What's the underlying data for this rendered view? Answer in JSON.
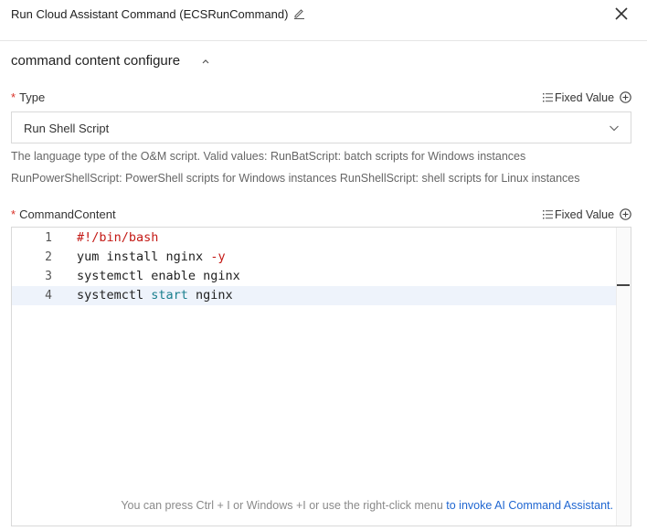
{
  "header": {
    "title": "Run Cloud Assistant Command (ECSRunCommand)",
    "edit_icon": "pencil-icon",
    "close_icon": "close-icon"
  },
  "section": {
    "title": "command content configure",
    "collapse_icon": "chevron-up-icon"
  },
  "type_field": {
    "required_mark": "*",
    "label": "Type",
    "fixed_value_label": "Fixed Value",
    "selected_value": "Run Shell Script",
    "help_line_1": "The language type of the O&M script. Valid values: RunBatScript: batch scripts for Windows instances",
    "help_line_2": "RunPowerShellScript: PowerShell scripts for Windows instances RunShellScript: shell scripts for Linux instances"
  },
  "command_field": {
    "required_mark": "*",
    "label": "CommandContent",
    "fixed_value_label": "Fixed Value",
    "active_line": 4,
    "lines": [
      {
        "num": "1",
        "text": "#!/bin/bash"
      },
      {
        "num": "2",
        "text_a": "yum install nginx ",
        "text_b": "-y"
      },
      {
        "num": "3",
        "text": "systemctl enable nginx"
      },
      {
        "num": "4",
        "text_a": "systemctl ",
        "text_b": "start",
        "text_c": " nginx"
      }
    ],
    "hint_text": "You can press Ctrl + I or Windows +I or use the right-click menu ",
    "hint_link": "to invoke AI Command Assistant."
  },
  "colors": {
    "required": "#d93026",
    "link": "#1f66d1",
    "comment": "#c41a16",
    "keyword": "#1a7f8e",
    "active_line_bg": "#eef3fb"
  }
}
